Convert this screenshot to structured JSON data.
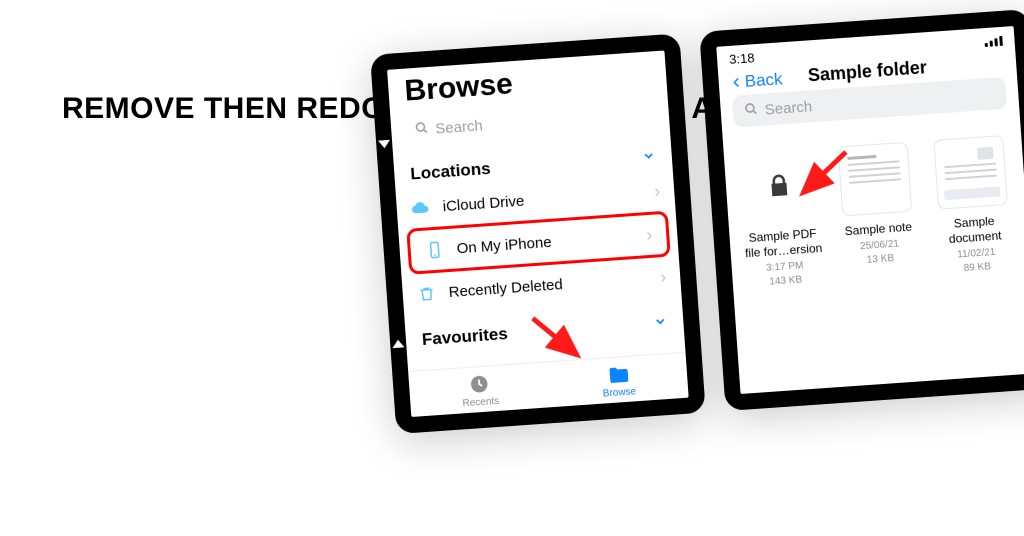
{
  "headline": "REMOVE THEN REDOWNLOAD CORRUPT ATTACHMENT",
  "leftPhone": {
    "title": "Browse",
    "searchPlaceholder": "Search",
    "sections": {
      "locations": {
        "header": "Locations",
        "items": [
          {
            "label": "iCloud Drive"
          },
          {
            "label": "On My iPhone"
          },
          {
            "label": "Recently Deleted"
          }
        ]
      },
      "favourites": {
        "header": "Favourites"
      }
    },
    "tabs": {
      "recents": "Recents",
      "browse": "Browse"
    }
  },
  "rightPhone": {
    "time": "3:18",
    "back": "Back",
    "title": "Sample folder",
    "searchPlaceholder": "Search",
    "files": [
      {
        "name": "Sample PDF file for…ersion",
        "date": "3:17 PM",
        "size": "143 KB"
      },
      {
        "name": "Sample note",
        "date": "25/06/21",
        "size": "13 KB"
      },
      {
        "name": "Sample document",
        "date": "11/02/21",
        "size": "89 KB"
      }
    ]
  }
}
